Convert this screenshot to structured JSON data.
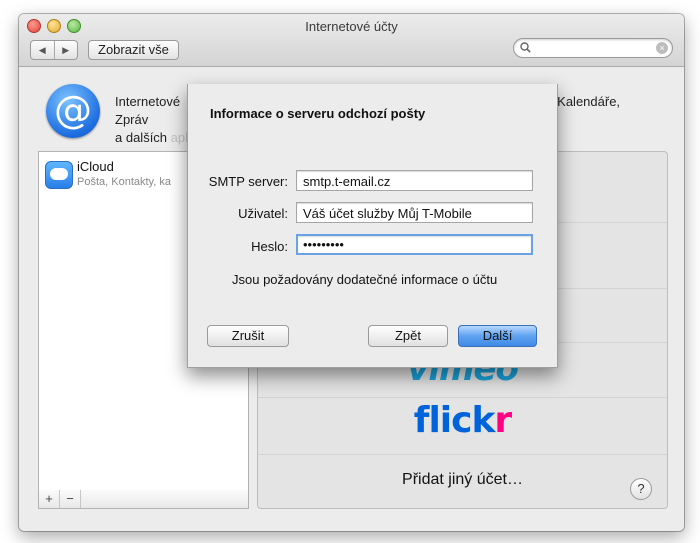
{
  "window": {
    "title": "Internetové účty"
  },
  "toolbar": {
    "show_all_label": "Zobrazit vše",
    "back_icon": "◀",
    "forward_icon": "▶",
    "search_value": "",
    "clear_icon": "×"
  },
  "intro": {
    "text_visible": "Internetové",
    "text_right": "alu, Kontaktů, Kalendáře, Zpráv",
    "text_line2": "a dalších",
    "text_line2_faded": "aplikací."
  },
  "accounts": [
    {
      "name": "iCloud",
      "subtitle": "Pošta, Kontakty, ka"
    }
  ],
  "list_footer": {
    "add_label": "+",
    "remove_label": "−"
  },
  "providers": {
    "vimeo": "vimeo",
    "flickr_1": "flick",
    "flickr_2": "r",
    "add_other": "Přidat jiný účet…"
  },
  "help_label": "?",
  "sheet": {
    "title": "Informace o serveru odchozí pošty",
    "smtp_label": "SMTP server:",
    "smtp_value": "smtp.t-email.cz",
    "user_label": "Uživatel:",
    "user_value": "Váš účet služby Můj T-Mobile",
    "password_label": "Heslo:",
    "password_value": "•••••••••",
    "note": "Jsou požadovány dodatečné informace o účtu",
    "cancel_label": "Zrušit",
    "back_label": "Zpět",
    "next_label": "Další"
  },
  "colors": {
    "accent": "#3f8ae8",
    "vimeo": "#1aa4de",
    "flickr_blue": "#0063dc",
    "flickr_pink": "#ff0084"
  }
}
